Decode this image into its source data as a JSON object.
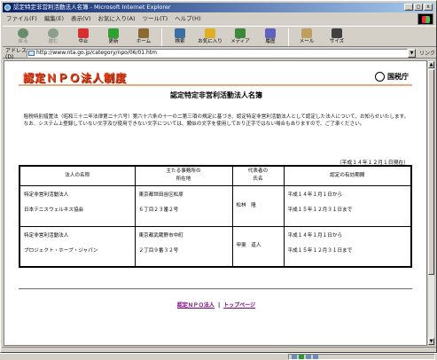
{
  "window": {
    "title": "認定特定非営利活動法人名簿 - Microsoft Internet Explorer",
    "minimize": "_",
    "maximize": "□",
    "close": "x"
  },
  "menu": [
    "ファイル(F)",
    "編集(E)",
    "表示(V)",
    "お気に入り(A)",
    "ツール(T)",
    "ヘルプ(H)"
  ],
  "toolbar": [
    {
      "label": "戻る",
      "icon": "back-arrow-icon",
      "color": "#6a8c6a",
      "enabled": false
    },
    {
      "label": "進む",
      "icon": "forward-arrow-icon",
      "color": "#8aa08a",
      "enabled": false
    },
    {
      "label": "中止",
      "icon": "stop-icon",
      "color": "#d83030",
      "enabled": true
    },
    {
      "label": "更新",
      "icon": "refresh-icon",
      "color": "#30a030",
      "enabled": true
    },
    {
      "label": "ホーム",
      "icon": "home-icon",
      "color": "#8a6a30",
      "enabled": true
    },
    {
      "label": "検索",
      "icon": "search-icon",
      "color": "#3a6ea5",
      "enabled": true
    },
    {
      "label": "お気に入り",
      "icon": "favorites-icon",
      "color": "#e0b020",
      "enabled": true
    },
    {
      "label": "メディア",
      "icon": "media-icon",
      "color": "#3a8a3a",
      "enabled": true
    },
    {
      "label": "履歴",
      "icon": "history-icon",
      "color": "#6060c0",
      "enabled": true
    },
    {
      "label": "メール",
      "icon": "mail-icon",
      "color": "#c0a060",
      "enabled": true
    },
    {
      "label": "サイズ",
      "icon": "font-size-icon",
      "color": "#404040",
      "enabled": true
    }
  ],
  "address": {
    "label": "アドレス(D)",
    "url": "http://www.nta.go.jp/category/npo/06/01.htm",
    "links": "リンク"
  },
  "page": {
    "logo": "認定ＮＰＯ法人制度",
    "agency": "国税庁",
    "title": "認定特定非営利活動法人名簿",
    "intro_1": "　租税特別措置法（昭和三十二年法律第二十六号）第六十六条の十一の二第三項の規定に基づき、認定特定非営利活動法人として認定した法人について、お知らせいたします。",
    "intro_2": "　なお、システム上登録していない文字及び使用できない文字については、類似の文字を使用しており正字ではない場合もありますので、ご了承ください。",
    "as_of": "（平成１４年１２月１日現在）"
  },
  "table": {
    "headers": [
      "法人の名称",
      "主たる事務所の\n所在地",
      "代表者の\n氏名",
      "認定の有効期間"
    ],
    "rows": [
      {
        "name_1": "特定非営利活動法人",
        "name_2": "日本テニスウェルネス協会",
        "addr_1": "東京都世田谷区松原",
        "addr_2": "６丁目２３番２号",
        "rep": "松林　隆",
        "period_1": "平成１４年１月１日から",
        "period_2": "平成１５年１２月３１日まで"
      },
      {
        "name_1": "特定非営利活動法人",
        "name_2": "プロジェクト・ホープ・ジャパン",
        "addr_1": "東京都武蔵野市中町",
        "addr_2": "２丁目９番３２号",
        "rep": "甲斐　道人",
        "period_1": "平成１４年１月１日から",
        "period_2": "平成１５年１２月３１日まで"
      }
    ]
  },
  "footer": {
    "link_1": "認定ＮＰＯ法人",
    "separator": "|",
    "link_2": "トップページ"
  }
}
